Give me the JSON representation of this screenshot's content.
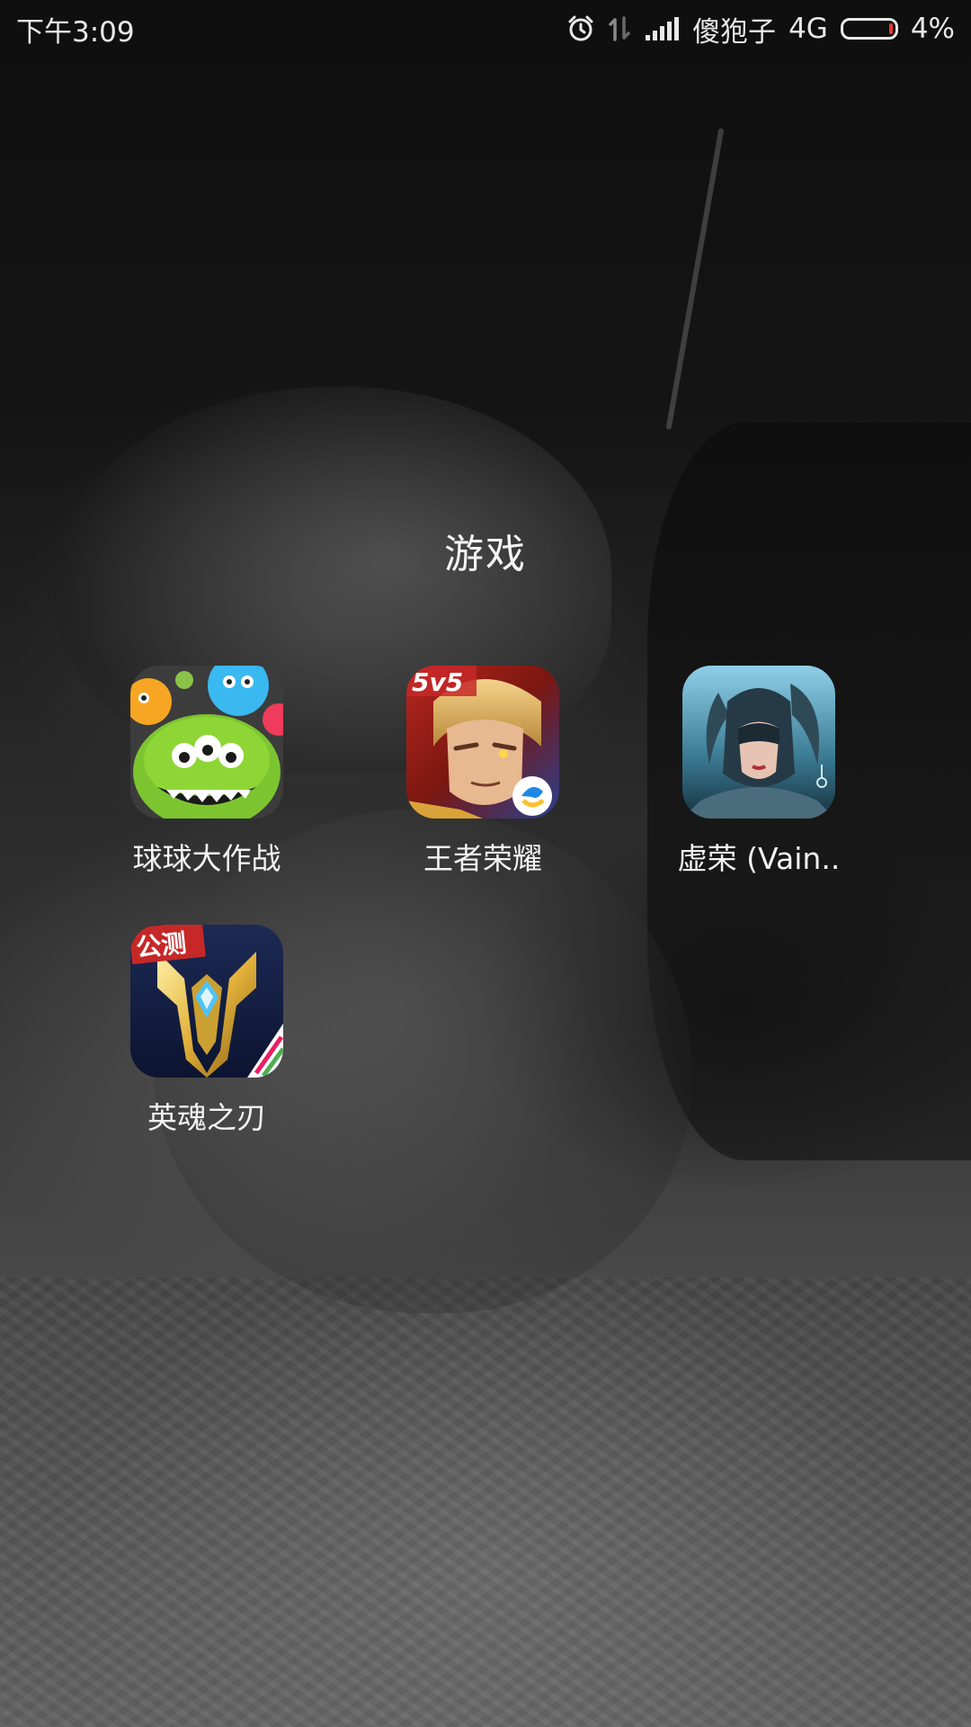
{
  "status_bar": {
    "time": "下午3:09",
    "carrier": "傻狍子",
    "network": "4G",
    "battery_percent": "4%",
    "battery_level": 0.04,
    "icons": [
      "alarm-clock-icon",
      "data-transfer-icon",
      "signal-strength-icon",
      "battery-icon"
    ]
  },
  "folder": {
    "title": "游戏",
    "apps": [
      {
        "label": "球球大作战",
        "icon": "ball-battle-app-icon"
      },
      {
        "label": "王者荣耀",
        "icon": "honor-of-kings-app-icon",
        "badge": "5v5"
      },
      {
        "label": "虚荣 (Vain..",
        "icon": "vainglory-app-icon"
      },
      {
        "label": "英魂之刃",
        "icon": "soul-blade-app-icon",
        "badge": "公测"
      }
    ]
  },
  "colors": {
    "text": "#ffffff",
    "battery_low": "#e53935"
  }
}
